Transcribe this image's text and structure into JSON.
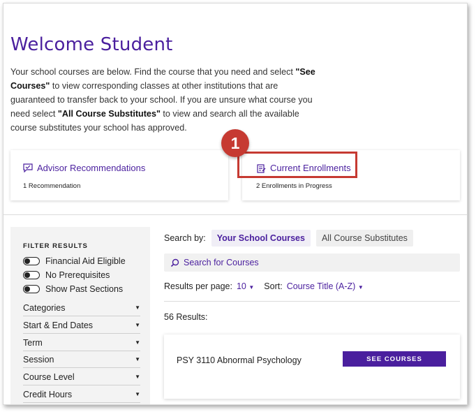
{
  "header": {
    "title": "Welcome Student",
    "intro": {
      "p1": "Your school courses are below. Find the course that you need and select ",
      "b1": "\"See Courses\"",
      "p2": " to view corresponding classes at other institutions that are guaranteed to transfer back to your school. If you are unsure what course you need select ",
      "b2": "\"All Course Substitutes\"",
      "p3": " to view and search all the available course substitutes your school has approved."
    }
  },
  "cards": {
    "advisor": {
      "label": "Advisor Recommendations",
      "sub": "1 Recommendation",
      "icon": "chat-check-icon"
    },
    "enrollments": {
      "label": "Current Enrollments",
      "sub": "2 Enrollments in Progress",
      "icon": "clipboard-edit-icon"
    }
  },
  "callout": {
    "number": "1",
    "color": "#c63a32"
  },
  "filter": {
    "heading": "FILTER RESULTS",
    "toggles": [
      "Financial Aid Eligible",
      "No Prerequisites",
      "Show Past Sections"
    ],
    "dropdowns": [
      "Categories",
      "Start & End Dates",
      "Term",
      "Session",
      "Course Level",
      "Credit Hours"
    ]
  },
  "search": {
    "by_label": "Search by:",
    "tab_active": "Your School Courses",
    "tab_inactive": "All Course Substitutes",
    "placeholder": "Search for Courses"
  },
  "listing": {
    "rpp_label": "Results per page:",
    "rpp_value": "10",
    "sort_label": "Sort:",
    "sort_value": "Course Title (A-Z)",
    "results_count": "56 Results:"
  },
  "course": {
    "name": "PSY 3110 Abnormal Psychology",
    "button": "SEE COURSES"
  },
  "colors": {
    "brand": "#4a1f9e",
    "highlight": "#c63a32"
  }
}
